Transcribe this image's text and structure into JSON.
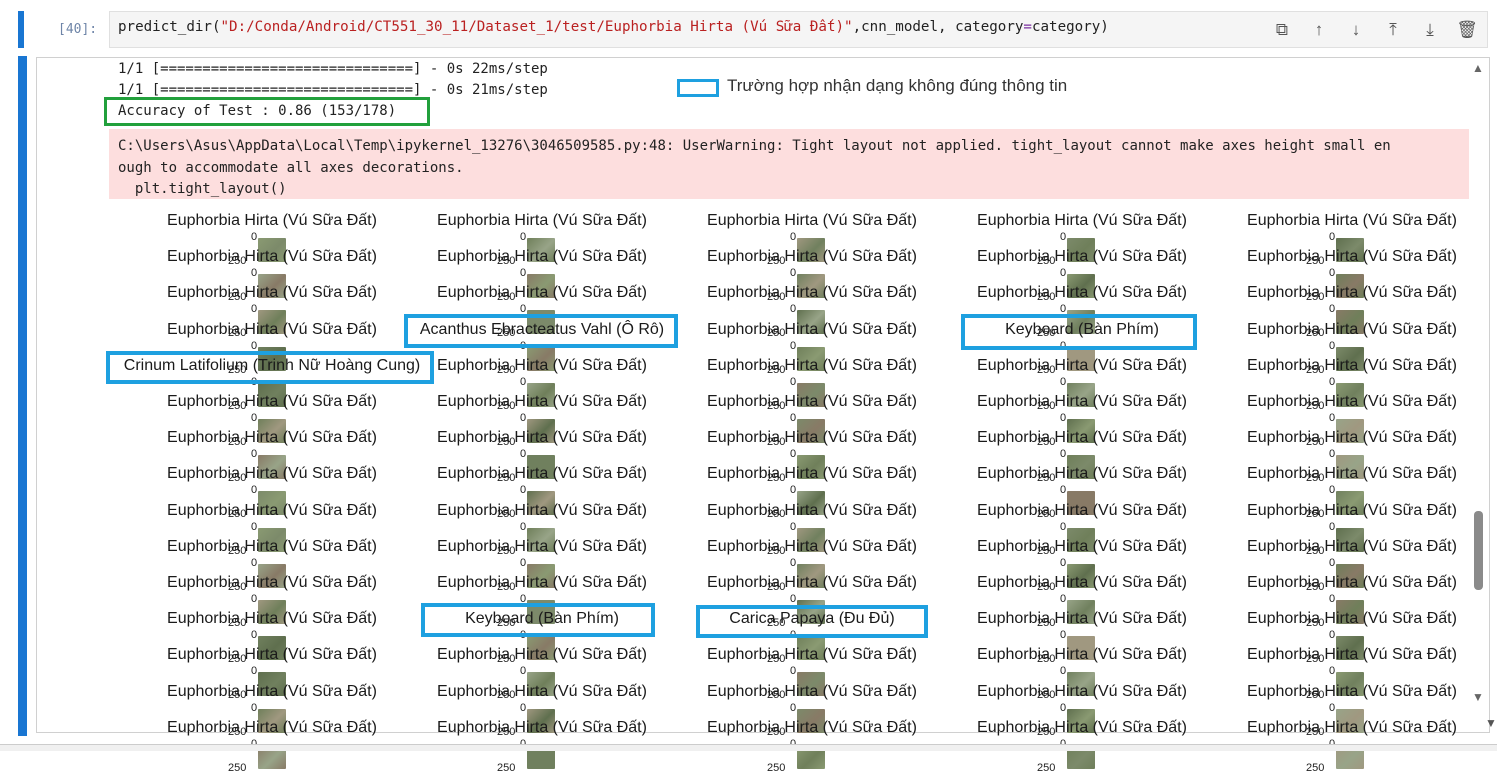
{
  "input_cell": {
    "prompt": "[40]:",
    "code": {
      "fn": "predict_dir(",
      "path": "\"D:/Conda/Android/CT551_30_11/Dataset_1/test/Euphorbia Hirta (Vú Sữa Đất)\"",
      "rest": ",cnn_model, category",
      "eq": "=",
      "arg": "category)"
    },
    "toolbar": [
      "duplicate-icon",
      "move-up-icon",
      "move-down-icon",
      "insert-above-icon",
      "insert-below-icon",
      "delete-icon"
    ]
  },
  "output": {
    "stream_lines": [
      "1/1 [==============================] - 0s 22ms/step",
      "1/1 [==============================] - 0s 21ms/step"
    ],
    "accuracy": "Accuracy of Test : 0.86 (153/178)",
    "stderr_lines": [
      "C:\\Users\\Asus\\AppData\\Local\\Temp\\ipykernel_13276\\3046509585.py:48: UserWarning: Tight layout not applied. tight_layout cannot make axes height small en",
      "ough to accommodate all axes decorations.",
      "  plt.tight_layout()"
    ],
    "legend_text": "Trường hợp nhận dạng không đúng thông tin"
  },
  "grid": {
    "default_title": "Euphorbia Hirta (Vú Sữa Đất)",
    "tick_top": "0",
    "tick_mid": "250",
    "misclassified": [
      {
        "row": 3,
        "col": 1,
        "label": "Acanthus Ebracteatus Vahl (Ô Rô)"
      },
      {
        "row": 3,
        "col": 3,
        "label": "Keyboard (Bàn Phím)"
      },
      {
        "row": 4,
        "col": 0,
        "label": "Crinum Latifolium (Trinh Nữ Hoàng Cung)"
      },
      {
        "row": 11,
        "col": 1,
        "label": "Keyboard (Bàn Phím)"
      },
      {
        "row": 11,
        "col": 2,
        "label": "Carica Papaya (Đu Đủ)"
      }
    ],
    "highlight_color": "#1ea0e0",
    "accuracy_box_color": "#22a03c"
  }
}
